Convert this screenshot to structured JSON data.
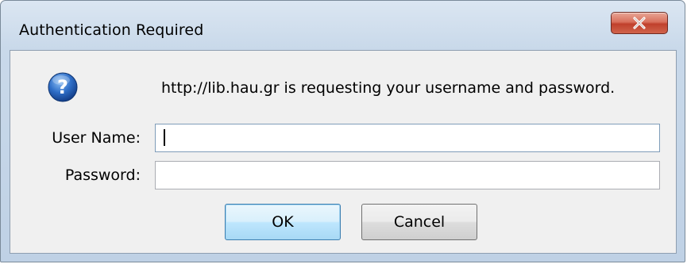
{
  "window": {
    "title": "Authentication Required",
    "close_icon": "close-x-icon"
  },
  "dialog": {
    "icon": "question-icon",
    "message": "http://lib.hau.gr is requesting your username and password.",
    "username_label": "User Name:",
    "username_value": "",
    "password_label": "Password:",
    "password_value": ""
  },
  "buttons": {
    "ok_label": "OK",
    "cancel_label": "Cancel"
  },
  "colors": {
    "titlebar": "#c9d9ea",
    "client_bg": "#f0f0f0",
    "close_button": "#c0402c",
    "question_icon": "#2a64b8",
    "default_button_border": "#3c7fb1"
  }
}
